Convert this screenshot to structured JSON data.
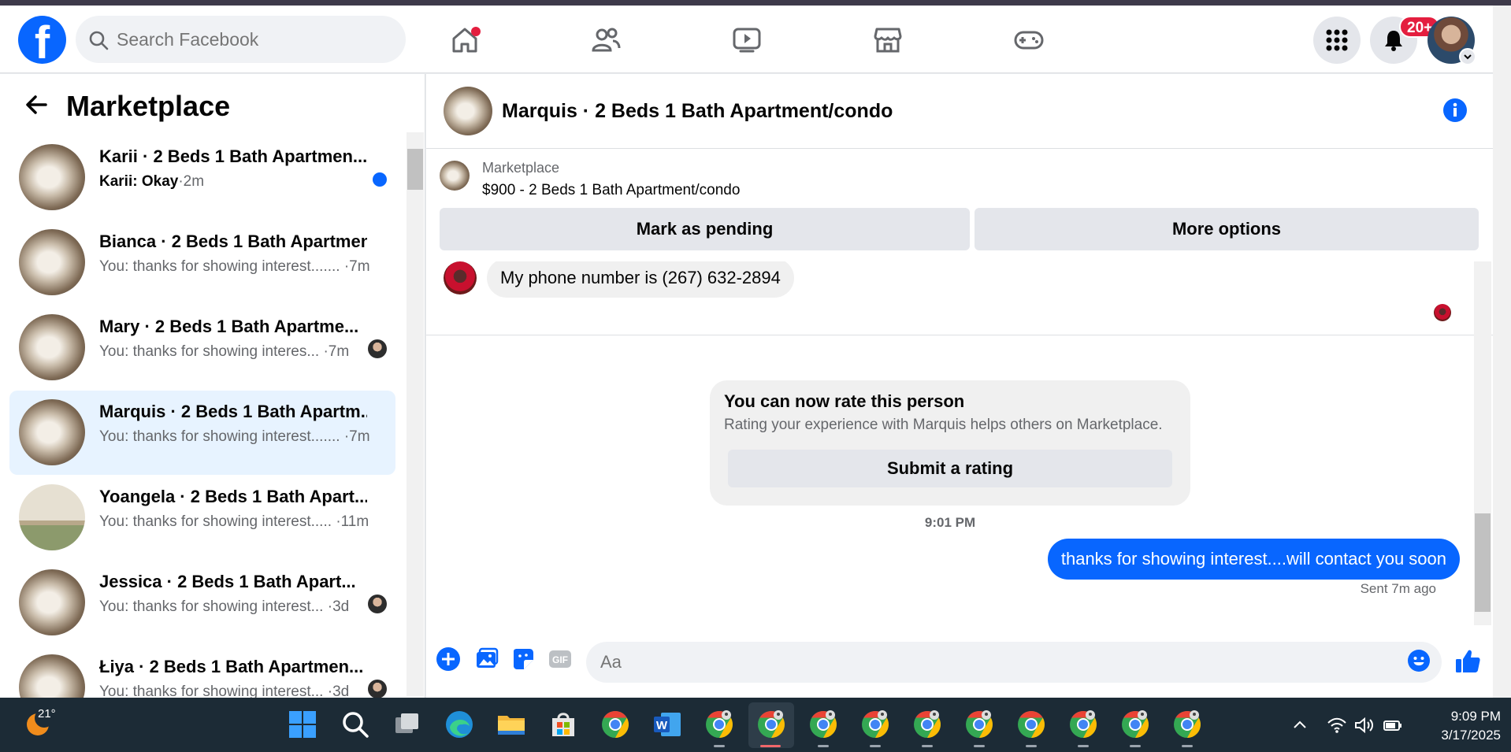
{
  "topbar": {
    "search_placeholder": "Search Facebook",
    "notification_badge": "20+",
    "nav": [
      "home-icon",
      "friends-icon",
      "watch-icon",
      "marketplace-icon",
      "gaming-icon"
    ],
    "colors": {
      "brand": "#0866ff",
      "badge": "#e41e3f"
    }
  },
  "sidebar": {
    "title": "Marketplace",
    "conversations": [
      {
        "title": "Karii · 2 Beds 1 Bath Apartmen...",
        "preview_sender": "Karii:",
        "preview": "Okay",
        "time": "·2m",
        "unread": true
      },
      {
        "title": "Bianca · 2 Beds 1 Bath Apartmen...",
        "preview": "You: thanks for showing interest.......",
        "time": "·7m"
      },
      {
        "title": "Mary · 2 Beds 1 Bath Apartme...",
        "preview": "You: thanks for showing interes...",
        "time": "·7m"
      },
      {
        "title": "Marquis · 2 Beds 1 Bath Apartm...",
        "preview": "You: thanks for showing interest.......",
        "time": "·7m",
        "active": true
      },
      {
        "title": "Yoangela · 2 Beds 1 Bath Apart...",
        "preview": "You: thanks for showing interest.....",
        "time": "·11m"
      },
      {
        "title": "Jessica · 2 Beds 1 Bath Apart...",
        "preview": "You: thanks for showing interest...",
        "time": "·3d"
      },
      {
        "title": "Łiya · 2 Beds 1 Bath Apartmen...",
        "preview": "You: thanks for showing interest...",
        "time": "·3d"
      }
    ]
  },
  "chat": {
    "title": "Marquis · 2 Beds 1 Bath Apartment/condo",
    "listing": {
      "label": "Marketplace",
      "price_title": "$900 - 2 Beds 1 Bath Apartment/condo",
      "pending_button": "Mark as pending",
      "more_button": "More options"
    },
    "incoming_message": "My phone number is (267) 632-2894",
    "rating": {
      "title": "You can now rate this person",
      "description": "Rating your experience with Marquis helps others on Marketplace.",
      "button": "Submit a rating"
    },
    "timestamp": "9:01 PM",
    "outgoing_message": "thanks for showing interest....will contact you soon",
    "sent_status": "Sent 7m ago",
    "composer_placeholder": "Aa"
  },
  "taskbar": {
    "weather_temp": "21°",
    "time": "9:09 PM",
    "date": "3/17/2025"
  }
}
